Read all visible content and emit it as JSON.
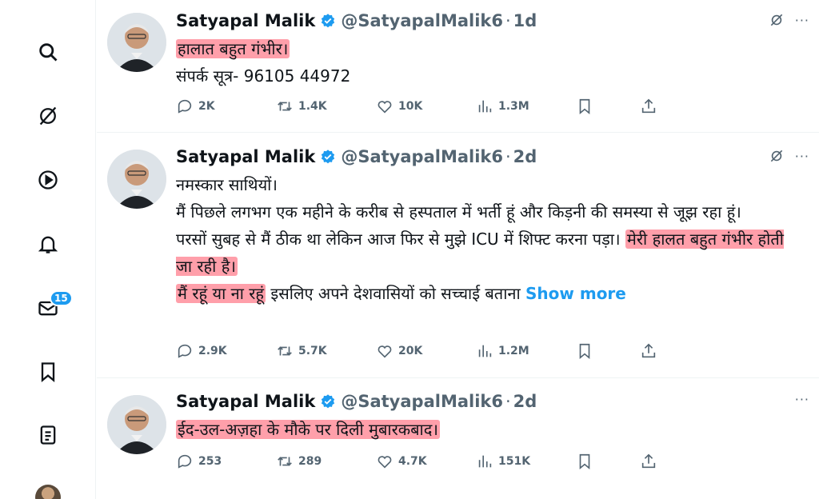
{
  "nav": {
    "items": [
      {
        "icon": "search-icon"
      },
      {
        "icon": "x-logo-icon"
      },
      {
        "icon": "play-icon"
      },
      {
        "icon": "bell-icon"
      },
      {
        "icon": "mail-icon",
        "badge": "15"
      },
      {
        "icon": "bookmark-icon"
      },
      {
        "icon": "list-icon"
      }
    ]
  },
  "tweets": [
    {
      "name": "Satyapal Malik",
      "handle": "@SatyapalMalik6",
      "dot": "·",
      "time": "1d",
      "more": "···",
      "lines": [
        {
          "hl": "हालात बहुत गंभीर।"
        },
        {
          "text": "संपर्क सूत्र- 96105 44972"
        }
      ],
      "stats": {
        "replies": "2K",
        "retweets": "1.4K",
        "likes": "10K",
        "views": "1.3M"
      }
    },
    {
      "name": "Satyapal Malik",
      "handle": "@SatyapalMalik6",
      "dot": "·",
      "time": "2d",
      "more": "···",
      "lines": [
        {
          "text": "नमस्कार साथियों।"
        },
        {
          "text": "मैं पिछले लगभग एक महीने के करीब से हस्पताल में भर्ती हूं और किड़नी की समस्या से जूझ रहा हूं।"
        },
        {
          "text_pre": "परसों सुबह से मैं ठीक था लेकिन आज फिर से मुझे ICU में शिफ्ट करना पड़ा। ",
          "hl": "मेरी हालत बहुत गंभीर होती जा रही है।"
        },
        {
          "hl": "मैं रहूं या ना रहूं",
          "text_post": " इसलिए अपने देशवासियों को सच्चाई बताना ",
          "show_more": "Show more"
        }
      ],
      "stats": {
        "replies": "2.9K",
        "retweets": "5.7K",
        "likes": "20K",
        "views": "1.2M"
      }
    },
    {
      "name": "Satyapal Malik",
      "handle": "@SatyapalMalik6",
      "dot": "·",
      "time": "2d",
      "more": "···",
      "lines": [
        {
          "hl": "ईद-उल-अज़हा के मौके पर दिली मुबारकबाद।"
        }
      ],
      "stats": {
        "replies": "253",
        "retweets": "289",
        "likes": "4.7K",
        "views": "151K"
      }
    }
  ],
  "colors": {
    "accent": "#1d9bf0",
    "highlight": "#ff5064",
    "muted": "#536471"
  }
}
